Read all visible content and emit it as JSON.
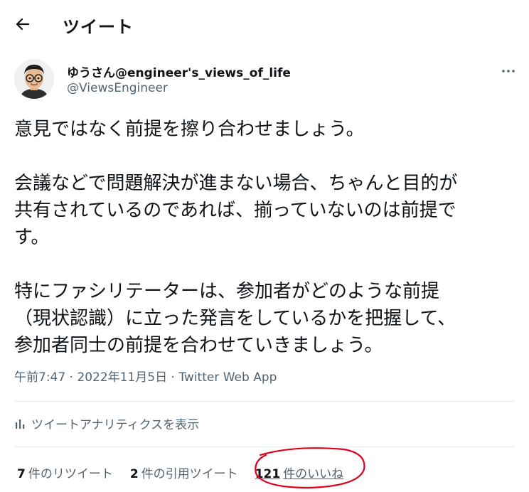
{
  "header": {
    "title": "ツイート"
  },
  "author": {
    "display_name": "ゆうさん@engineer's_views_of_life",
    "handle": "@ViewsEngineer"
  },
  "tweet": {
    "paragraphs": [
      [
        "意見ではなく前提を擦り合わせましょう。"
      ],
      [
        "会議などで問題解決が進まない場合、ちゃんと目的が",
        "共有されているのであれば、揃っていないのは前提で",
        "す。"
      ],
      [
        "特にファシリテーターは、参加者がどのような前提",
        "（現状認識）に立った発言をしているかを把握して、",
        "参加者同士の前提を合わせていきましょう。"
      ]
    ],
    "time": "午前7:47",
    "date": "2022年11月5日",
    "separator": " · ",
    "source": "Twitter Web App"
  },
  "analytics": {
    "label": "ツイートアナリティクスを表示"
  },
  "stats": {
    "retweets": {
      "count": "7",
      "label": "件のリツイート"
    },
    "quotes": {
      "count": "2",
      "label": "件の引用ツイート"
    },
    "likes": {
      "count": "121",
      "label": "件のいいね"
    }
  },
  "colors": {
    "text": "#0f1419",
    "secondary": "#536471",
    "divider": "#e6ecf0",
    "annotation": "#e0001b"
  },
  "icons": {
    "back": "arrow-left-icon",
    "more": "more-dots-icon",
    "analytics": "bar-chart-icon"
  }
}
